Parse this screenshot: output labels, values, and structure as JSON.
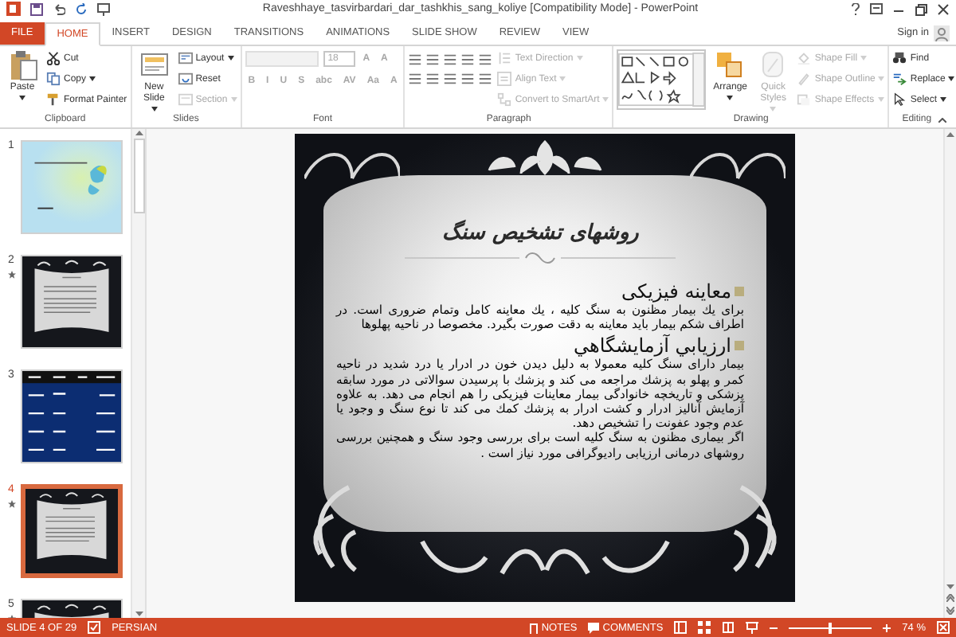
{
  "window": {
    "title": "Raveshhaye_tasvirbardari_dar_tashkhis_sang_koliye [Compatibility Mode] - PowerPoint"
  },
  "tabs": [
    {
      "label": "FILE",
      "kind": "file",
      "selected": false
    },
    {
      "label": "HOME",
      "kind": "tab",
      "selected": true
    },
    {
      "label": "INSERT",
      "kind": "tab",
      "selected": false
    },
    {
      "label": "DESIGN",
      "kind": "tab",
      "selected": false
    },
    {
      "label": "TRANSITIONS",
      "kind": "tab",
      "selected": false
    },
    {
      "label": "ANIMATIONS",
      "kind": "tab",
      "selected": false
    },
    {
      "label": "SLIDE SHOW",
      "kind": "tab",
      "selected": false
    },
    {
      "label": "REVIEW",
      "kind": "tab",
      "selected": false
    },
    {
      "label": "VIEW",
      "kind": "tab",
      "selected": false
    }
  ],
  "account": {
    "label": "Sign in"
  },
  "ribbon": {
    "groups": [
      {
        "label": "Clipboard",
        "kind": "buttons",
        "items": [
          {
            "label": "Paste",
            "kind": "large",
            "disabled": false,
            "dropdown": true
          },
          {
            "label": "Cut",
            "kind": "small",
            "disabled": false,
            "dropdown": false
          },
          {
            "label": "Copy",
            "kind": "small",
            "disabled": false,
            "dropdown": true
          },
          {
            "label": "Format Painter",
            "kind": "small",
            "disabled": false,
            "dropdown": false
          }
        ]
      },
      {
        "label": "Slides",
        "kind": "buttons",
        "items": [
          {
            "label": "New Slide",
            "kind": "large",
            "disabled": false,
            "dropdown": true
          },
          {
            "label": "Layout",
            "kind": "small",
            "disabled": false,
            "dropdown": true
          },
          {
            "label": "Reset",
            "kind": "small",
            "disabled": false,
            "dropdown": false
          },
          {
            "label": "Section",
            "kind": "small",
            "disabled": true,
            "dropdown": true
          }
        ]
      },
      {
        "label": "Font",
        "kind": "font",
        "disabled": true,
        "size": "18",
        "grow_buttons": [
          "A",
          "A"
        ],
        "buttons": [
          "B",
          "I",
          "U",
          "S",
          "abc",
          "AV",
          "Aa",
          "A"
        ]
      },
      {
        "label": "Paragraph",
        "kind": "paragraph",
        "items": [
          {
            "label": "Text Direction",
            "kind": "small",
            "disabled": true,
            "dropdown": true
          },
          {
            "label": "Align Text",
            "kind": "small",
            "disabled": true,
            "dropdown": true
          },
          {
            "label": "Convert to SmartArt",
            "kind": "small",
            "disabled": true,
            "dropdown": true
          }
        ]
      },
      {
        "label": "Drawing",
        "kind": "drawing",
        "items": [
          {
            "label": "Arrange",
            "kind": "large",
            "disabled": false,
            "dropdown": true
          },
          {
            "label": "Quick Styles",
            "kind": "large",
            "disabled": true,
            "dropdown": true
          },
          {
            "label": "Shape Fill",
            "kind": "small",
            "disabled": true,
            "dropdown": true
          },
          {
            "label": "Shape Outline",
            "kind": "small",
            "disabled": true,
            "dropdown": true
          },
          {
            "label": "Shape Effects",
            "kind": "small",
            "disabled": true,
            "dropdown": true
          }
        ]
      },
      {
        "label": "Editing",
        "kind": "buttons",
        "items": [
          {
            "label": "Find",
            "kind": "small",
            "disabled": false,
            "dropdown": false
          },
          {
            "label": "Replace",
            "kind": "small",
            "disabled": false,
            "dropdown": true
          },
          {
            "label": "Select",
            "kind": "small",
            "disabled": false,
            "dropdown": true
          }
        ]
      }
    ]
  },
  "thumbnails": [
    {
      "number": "1",
      "kind": "title",
      "selected": false,
      "animated": false
    },
    {
      "number": "2",
      "kind": "scroll",
      "selected": false,
      "animated": true
    },
    {
      "number": "3",
      "kind": "table",
      "selected": false,
      "animated": false
    },
    {
      "number": "4",
      "kind": "scroll",
      "selected": true,
      "animated": true
    },
    {
      "number": "5",
      "kind": "scroll",
      "selected": false,
      "animated": true
    }
  ],
  "slide": {
    "title": "روشهای تشخیص سنگ",
    "sections": [
      {
        "heading": "معاینه فیزیکی",
        "paragraphs": [
          "برای یك بیمار مظنون به سنگ کلیه ، یك معاینه کامل وتمام ضروری است. در اطراف شکم بیمار باید معاینه به دقت صورت بگیرد. مخصوصا در ناحیه پهلوها"
        ]
      },
      {
        "heading": "ارزيابي آزمايشگاهي",
        "paragraphs": [
          "بیمار دارای سنگ کلیه معمولا به دلیل دیدن خون در ادرار یا درد شدید در ناحیه کمر و پهلو به پزشك مراجعه می کند و پزشك با پرسیدن سوالاتی در مورد سابقه پزشکی و تاریخچه خانوادگی بیمار معاینات فیزیکی را هم انجام می دهد. به علاوه آزمایش آنالیز ادرار و کشت ادرار به پزشك کمك می کند تا نوع سنگ و وجود یا عدم وجود عفونت را تشخیص دهد.",
          "اگر بیماری مظنون به سنگ کلیه است برای بررسی وجود سنگ و همچنین بررسی روشهای درمانی ارزیابی رادیوگرافی مورد نیاز است ."
        ]
      }
    ]
  },
  "status": {
    "slide": "SLIDE 4 OF 29",
    "language": "PERSIAN",
    "notes": "NOTES",
    "comments": "COMMENTS",
    "zoom": {
      "level": 0.5,
      "label": "74 %"
    }
  }
}
